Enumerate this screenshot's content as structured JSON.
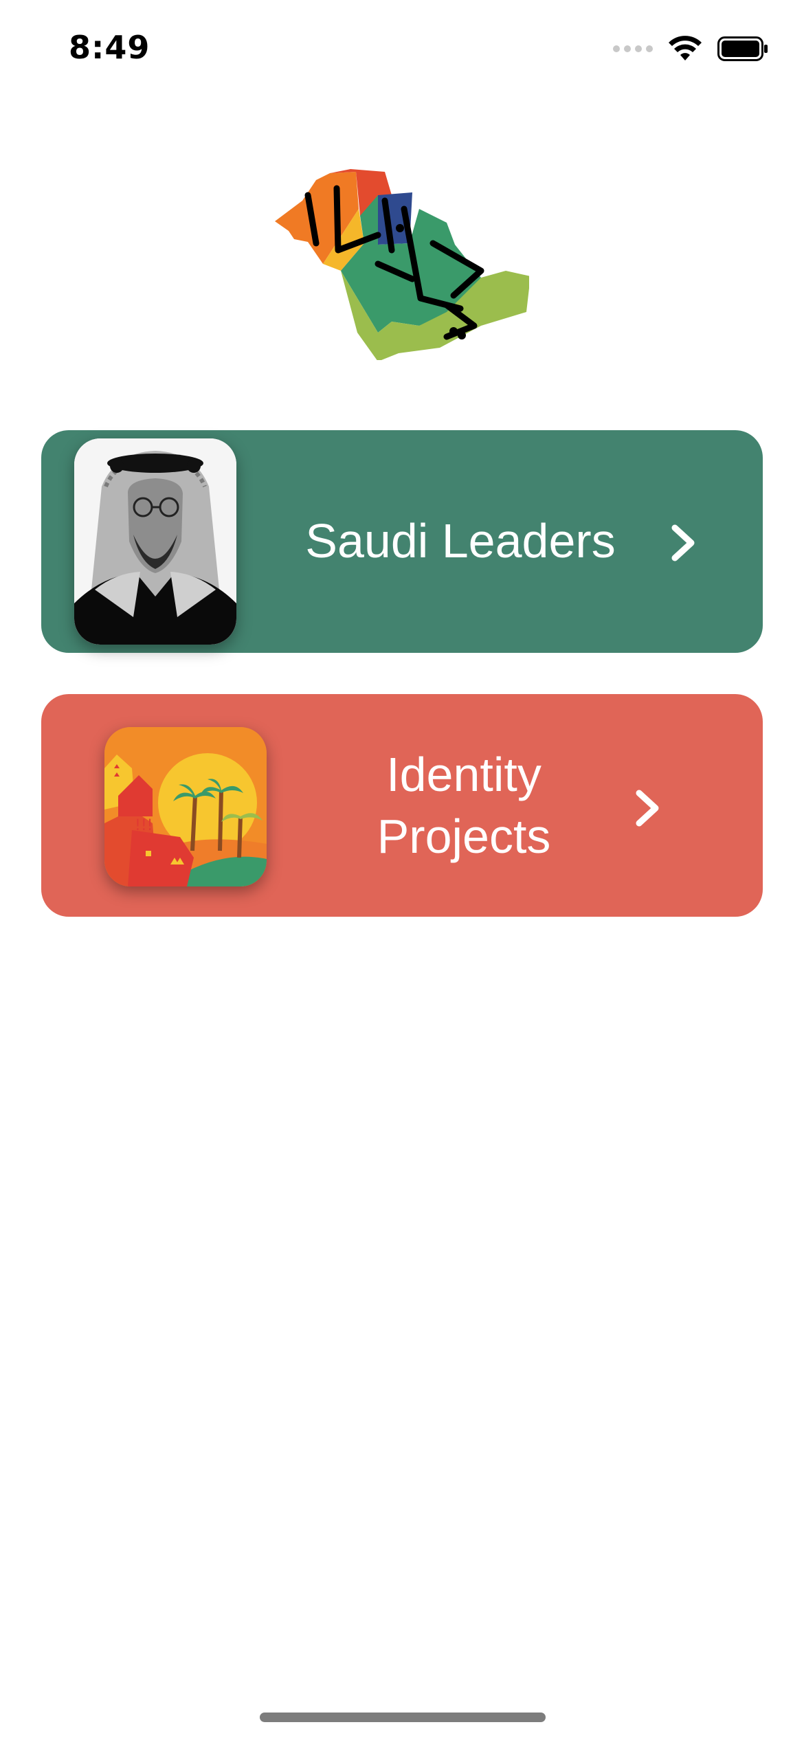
{
  "status_bar": {
    "time": "8:49",
    "icons": [
      "cellular-signal-icon",
      "wifi-icon",
      "battery-icon"
    ]
  },
  "logo": {
    "name": "saudi-map-logo",
    "lettering": "هي لنا دار"
  },
  "menu": {
    "items": [
      {
        "label": "Saudi Leaders",
        "thumbnail": "portrait-photo",
        "icon": "chevron-right-icon",
        "color": "#43836f"
      },
      {
        "label": "Identity\nProjects",
        "thumbnail": "desert-palm-illustration",
        "icon": "chevron-right-icon",
        "color": "#e06557"
      }
    ]
  },
  "colors": {
    "background": "#ffffff",
    "text_on_card": "#ffffff"
  }
}
